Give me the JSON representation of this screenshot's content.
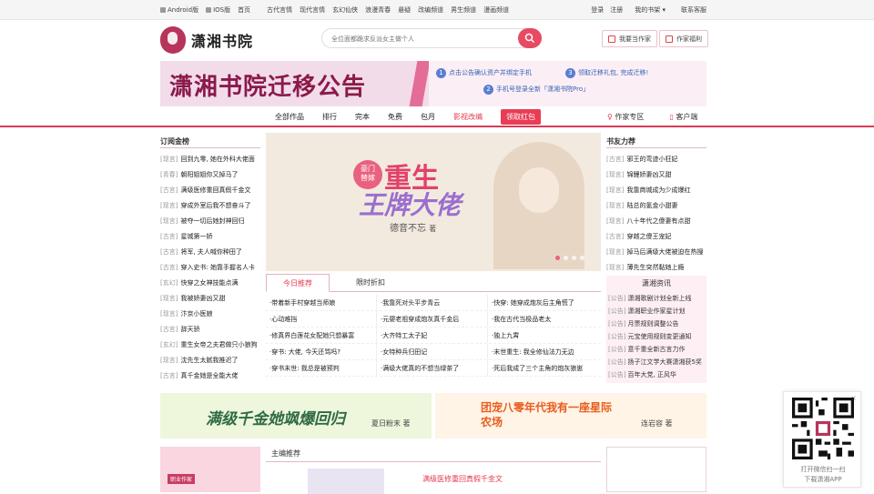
{
  "topbar": {
    "left": [
      "Android版",
      "IOS版",
      "首页",
      "古代言情",
      "现代言情",
      "玄幻仙侠",
      "浪漫青春",
      "悬疑",
      "改编频道",
      "男生频道",
      "漫画频道"
    ],
    "login": "登录",
    "register": "注册",
    "my_shelf": "我的书架",
    "service": "联系客服"
  },
  "header": {
    "logo_text": "潇湘书院",
    "search_placeholder": "全位面都跪求反派女主做个人",
    "author_btn": "我要当作家",
    "benefit_btn": "作家福利"
  },
  "banner": {
    "title": "潇湘书院迁移公告",
    "step1": "点击公告确认资产并绑定手机",
    "step2": "手机号登录全新「潇湘书院Pro」",
    "step3": "领取迁移礼包, 完成迁移!",
    "num1": "1",
    "num2": "2",
    "num3": "3"
  },
  "nav": {
    "items": [
      "全部作品",
      "排行",
      "完本",
      "免费",
      "包月",
      "影视改编",
      "领取红包"
    ],
    "author_zone": "作家专区",
    "client": "客户端"
  },
  "rank": {
    "title": "订阅金榜",
    "items": [
      {
        "tag": "[现言]",
        "title": "回到九零, 她在外科大佬面"
      },
      {
        "tag": "[青春]",
        "title": "朝阳姐姐你又掉马了"
      },
      {
        "tag": "[古言]",
        "title": "满级医修重回真假千金文"
      },
      {
        "tag": "[现言]",
        "title": "穿成外室后我不想奋斗了"
      },
      {
        "tag": "[现言]",
        "title": "被夺一切后她封神回归"
      },
      {
        "tag": "[古言]",
        "title": "星城第一娇"
      },
      {
        "tag": "[古言]",
        "title": "将军, 夫人喊你种田了"
      },
      {
        "tag": "[古言]",
        "title": "穿入史书: 她靠手握名人卡"
      },
      {
        "tag": "[玄幻]",
        "title": "快穿之女神技能点满"
      },
      {
        "tag": "[现言]",
        "title": "我被娇妻凶又甜"
      },
      {
        "tag": "[现言]",
        "title": "汴京小医娘"
      },
      {
        "tag": "[古言]",
        "title": "辞天骄"
      },
      {
        "tag": "[玄幻]",
        "title": "重生女帝之夫君做只小狼狗"
      },
      {
        "tag": "[现言]",
        "title": "沈先生太腻我推迟了"
      },
      {
        "tag": "[古言]",
        "title": "真千金她是全能大佬"
      }
    ]
  },
  "recommend": {
    "title": "书友力荐",
    "items": [
      {
        "tag": "[古言]",
        "title": "邪王的弯迹小狂妃"
      },
      {
        "tag": "[现言]",
        "title": "锦鲤娇妻凶又甜"
      },
      {
        "tag": "[现言]",
        "title": "我靠商城成为少成爆红"
      },
      {
        "tag": "[现言]",
        "title": "陆总的氪金小甜妻"
      },
      {
        "tag": "[现言]",
        "title": "八十年代之傻妻有点甜"
      },
      {
        "tag": "[古言]",
        "title": "穿越之傻王宠妃"
      },
      {
        "tag": "[现言]",
        "title": "掉马后满级大佬被迫在热搜"
      },
      {
        "tag": "[现言]",
        "title": "薄先生突然黏她上瘾"
      }
    ]
  },
  "slider": {
    "subtitle_line1": "豪门",
    "subtitle_line2": "替嫁",
    "title_line1": "重生",
    "title_line2": "王牌大佬",
    "author": "德音不忘",
    "author_suffix": "著"
  },
  "tabs": {
    "today": "今日推荐",
    "limited": "限时折扣"
  },
  "grid": [
    [
      "·带着新手村穿越当师娘",
      "·我靠死对头平步青云",
      "·快穿: 她穿成炮灰后主角慌了"
    ],
    [
      "·心动难挡",
      "·元婴老祖穿成炮灰真千金后",
      "·我在古代当极品老太"
    ],
    [
      "·修真界白莲花女配她只想暴富",
      "·大齐特工太子妃",
      "·独上九霄"
    ],
    [
      "·穿书: 大佬, 今天还骂吗?",
      "·女特种兵归田记",
      "·末世重生: 我全修仙法力无边"
    ],
    [
      "·穿书末世: 我总是被预判",
      "·满级大佬真的不想当绿茶了",
      "·死后我成了三个主角的炮灰狼崽"
    ]
  ],
  "news": {
    "title": "潇湘资讯",
    "items": [
      {
        "tag": "[公告]",
        "title": "潇湘歌剧计划全新上线"
      },
      {
        "tag": "[公告]",
        "title": "潇湘职业作家星计划"
      },
      {
        "tag": "[公告]",
        "title": "月票规则调整公告"
      },
      {
        "tag": "[公告]",
        "title": "元宝使用规则变更通知"
      },
      {
        "tag": "[公告]",
        "title": "意千重全新古言力作"
      },
      {
        "tag": "[公告]",
        "title": "扬子江文学大赛潇湘获5奖"
      },
      {
        "tag": "[公告]",
        "title": "百年大党, 正风华"
      }
    ]
  },
  "ads": {
    "ad1_text": "满级千金她飒爆回归",
    "ad1_author": "夏日粉末 著",
    "ad2_text": "团宠八零年代我有一座星际农场",
    "ad2_author": "连岩容 著"
  },
  "bottom": {
    "tag": "职业作家",
    "editor_title": "主编推荐",
    "book_title": "满级医修重回真假千金文"
  },
  "qr": {
    "close": "×",
    "line1": "打开微信扫一扫",
    "line2": "下载潇湘APP"
  },
  "colors": {
    "accent": "#e33c50",
    "nav_border": "#d63c55",
    "banner_title": "#8b1a4a"
  }
}
